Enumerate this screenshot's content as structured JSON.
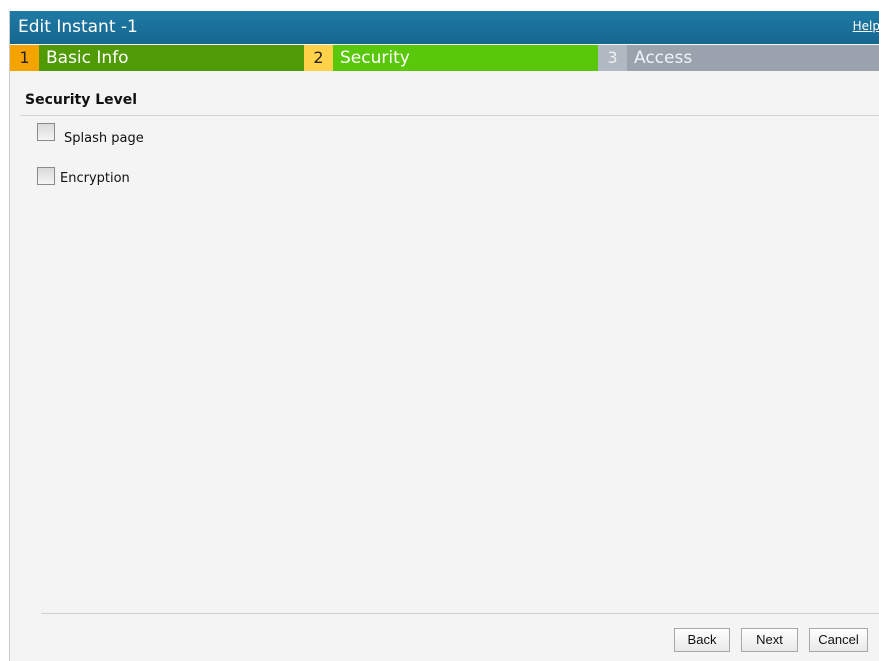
{
  "window": {
    "title": "Edit Instant -1",
    "help_label": "Help"
  },
  "steps": [
    {
      "number": "1",
      "label": "Basic Info",
      "state": "completed"
    },
    {
      "number": "2",
      "label": "Security",
      "state": "active"
    },
    {
      "number": "3",
      "label": "Access",
      "state": "pending"
    }
  ],
  "security": {
    "section_title": "Security Level",
    "options": [
      {
        "label": "Splash page",
        "checked": false
      },
      {
        "label": "Encryption",
        "checked": false
      }
    ]
  },
  "footer": {
    "back_label": "Back",
    "next_label": "Next",
    "cancel_label": "Cancel"
  },
  "colors": {
    "titlebar": "#1f7ba6",
    "step1_number": "#f5a300",
    "step1_label": "#4f9a05",
    "step2_number": "#ffd24a",
    "step2_label": "#5ac80a",
    "step3_number": "#b0b8c2",
    "step3_label": "#9aa2ad"
  }
}
